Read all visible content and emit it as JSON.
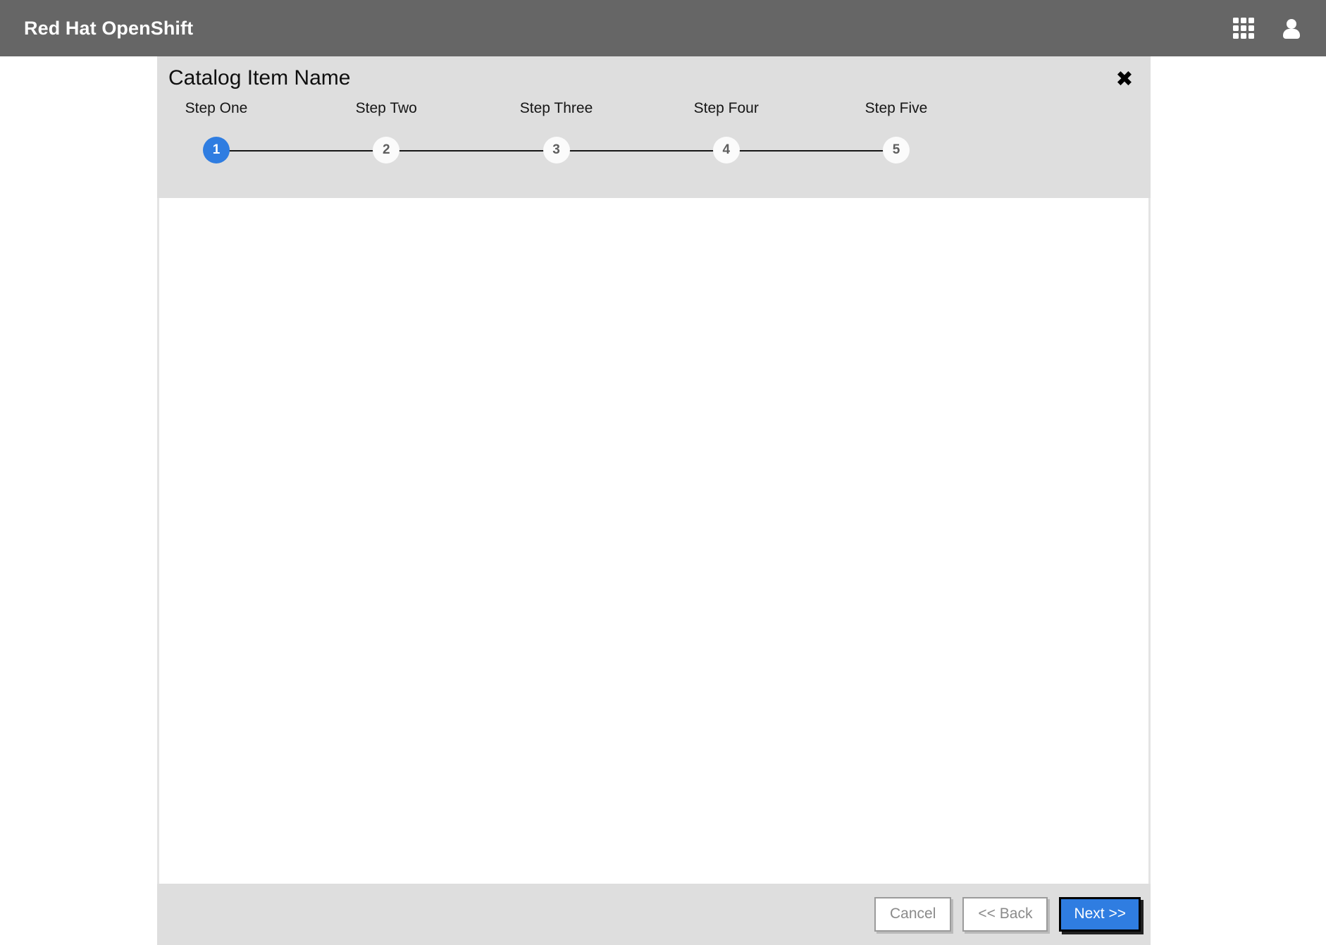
{
  "masthead": {
    "brand": "Red Hat OpenShift",
    "background_color": "#666666",
    "actions": [
      {
        "name": "app-launcher",
        "icon": "grid-icon",
        "label": ""
      },
      {
        "name": "user-menu",
        "icon": "user-icon",
        "label": ""
      }
    ]
  },
  "wizard": {
    "title": "Catalog Item Name",
    "close_label": "✖",
    "header_background": "#dedede",
    "active_step_color": "#2f7de1",
    "steps": [
      {
        "number": "1",
        "label": "Step One",
        "active": true
      },
      {
        "number": "2",
        "label": "Step Two",
        "active": false
      },
      {
        "number": "3",
        "label": "Step Three",
        "active": false
      },
      {
        "number": "4",
        "label": "Step Four",
        "active": false
      },
      {
        "number": "5",
        "label": "Step Five",
        "active": false
      }
    ],
    "body": {
      "content": ""
    },
    "footer": {
      "cancel_label": "Cancel",
      "back_label": "<< Back",
      "next_label": "Next >>"
    }
  }
}
